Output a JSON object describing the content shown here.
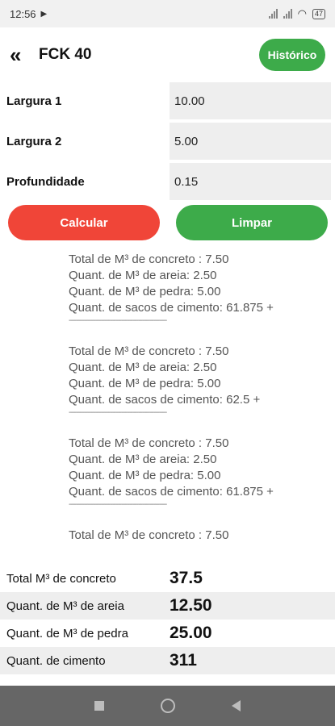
{
  "status_bar": {
    "time": "12:56",
    "battery": "47"
  },
  "header": {
    "title": "FCK 40",
    "history_label": "Histórico"
  },
  "form": {
    "fields": [
      {
        "label": "Largura 1",
        "value": "10.00"
      },
      {
        "label": "Largura 2",
        "value": "5.00"
      },
      {
        "label": "Profundidade",
        "value": "0.15"
      }
    ]
  },
  "actions": {
    "calc_label": "Calcular",
    "clear_label": "Limpar"
  },
  "results": [
    {
      "concreto": "Total de M³ de concreto : 7.50",
      "areia": "Quant. de M³ de areia: 2.50",
      "pedra": "Quant. de M³ de pedra: 5.00",
      "cimento": "Quant. de sacos de cimento: 61.875  +",
      "divider": "----------------------------------------------------"
    },
    {
      "concreto": "Total de M³ de concreto : 7.50",
      "areia": "Quant. de M³ de areia: 2.50",
      "pedra": "Quant. de M³ de pedra: 5.00",
      "cimento": "Quant. de sacos de cimento: 62.5  +",
      "divider": "----------------------------------------------------"
    },
    {
      "concreto": "Total de M³ de concreto : 7.50",
      "areia": "Quant. de M³ de areia: 2.50",
      "pedra": "Quant. de M³ de pedra: 5.00",
      "cimento": "Quant. de sacos de cimento: 61.875  +",
      "divider": "----------------------------------------------------"
    },
    {
      "concreto": "Total de M³ de concreto : 7.50",
      "areia": "",
      "pedra": "",
      "cimento": "",
      "divider": ""
    }
  ],
  "totals": [
    {
      "label": "Total M³ de concreto",
      "value": "37.5"
    },
    {
      "label": "Quant. de M³ de areia",
      "value": "12.50"
    },
    {
      "label": "Quant. de M³ de pedra",
      "value": "25.00"
    },
    {
      "label": "Quant. de cimento",
      "value": "311"
    }
  ]
}
